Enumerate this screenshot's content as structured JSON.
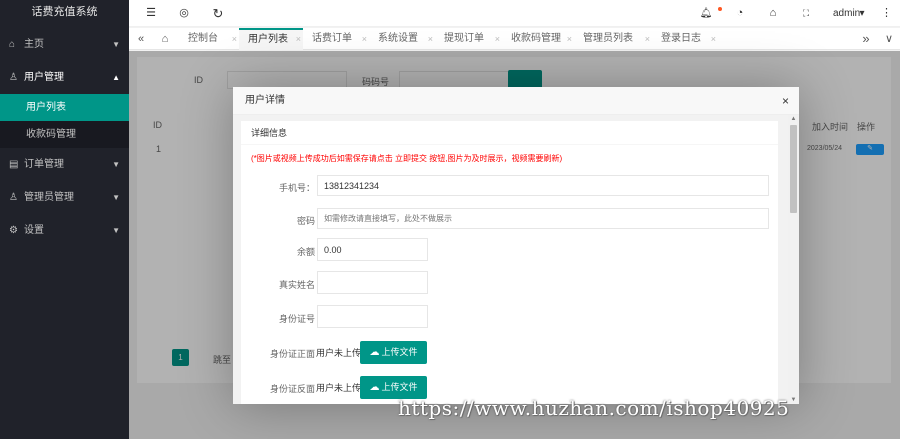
{
  "app": {
    "title": "话费充值系统"
  },
  "sidebar": {
    "items": [
      {
        "label": "主页",
        "icon": "home-icon",
        "glyph": "⌂",
        "arrow": "▼"
      },
      {
        "label": "用户管理",
        "icon": "user-icon",
        "glyph": "♙",
        "arrow": "▲"
      },
      {
        "label": "订单管理",
        "icon": "list-icon",
        "glyph": "▤",
        "arrow": "▼"
      },
      {
        "label": "管理员管理",
        "icon": "admin-icon",
        "glyph": "♙",
        "arrow": "▼"
      },
      {
        "label": "设置",
        "icon": "gear-icon",
        "glyph": "⚙",
        "arrow": "▼"
      }
    ],
    "subitems": [
      {
        "label": "用户列表",
        "active": true
      },
      {
        "label": "收款码管理",
        "active": false
      }
    ]
  },
  "header": {
    "menu_glyph": "☰",
    "theme_glyph": "◎",
    "refresh_glyph": "↻",
    "bell_glyph": "🔔︎",
    "dashboard_glyph": "◔",
    "tag_glyph": "⌂",
    "fullscreen_glyph": "⛶",
    "user": "admin",
    "user_arrow": "▾",
    "more_glyph": "⋮",
    "notice_color": "#ff5722"
  },
  "tabs": {
    "prev_glyph": "«",
    "home_glyph": "⌂",
    "next_glyph": "»",
    "menu_glyph": "∨",
    "close_glyph": "×",
    "items": [
      {
        "label": "控制台"
      },
      {
        "label": "用户列表"
      },
      {
        "label": "话费订单"
      },
      {
        "label": "系统设置"
      },
      {
        "label": "提现订单"
      },
      {
        "label": "收款码管理"
      },
      {
        "label": "管理员列表"
      },
      {
        "label": "登录日志"
      }
    ]
  },
  "background": {
    "search_id_label": "ID",
    "search_code_label": "码码号",
    "col_id": "ID",
    "col_join_time": "加入时间",
    "col_action": "操作",
    "row_id": "1",
    "row_date": "2023/05/24",
    "edit_glyph": "✎",
    "page_number": "1",
    "page_goto": "跳至"
  },
  "modal": {
    "title": "用户详情",
    "close_glyph": "×",
    "section_title": "详细信息",
    "notice": "(*图片或视频上传成功后如需保存请点击 立即提交 按钮,图片为及时展示，视频需要刷新)",
    "fields": {
      "phone": {
        "label": "手机号：",
        "value": "13812341234"
      },
      "password": {
        "label": "密码",
        "placeholder": "如需修改请直接填写，此处不做展示"
      },
      "balance": {
        "label": "余额",
        "value": "0.00"
      },
      "real_name": {
        "label": "真实姓名",
        "value": ""
      },
      "id_number": {
        "label": "身份证号",
        "value": ""
      },
      "id_front": {
        "label": "身份证正面",
        "status": "用户未上传",
        "button": "上传文件"
      },
      "id_back": {
        "label": "身份证反面",
        "status": "用户未上传",
        "button": "上传文件"
      }
    },
    "cloud_glyph": "☁",
    "scroll_up_glyph": "▲",
    "scroll_down_glyph": "▼"
  },
  "watermark": "https://www.huzhan.com/ishop40925",
  "colors": {
    "primary": "#009688",
    "sidebar": "#20222a",
    "danger": "#ff0000"
  }
}
